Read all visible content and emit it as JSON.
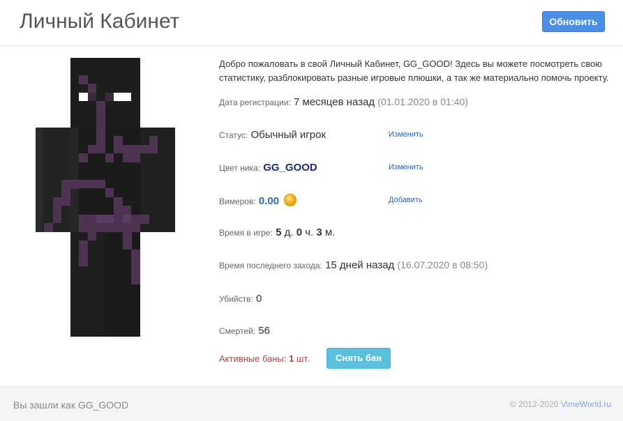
{
  "header": {
    "title": "Личный Кабинет",
    "refresh_label": "Обновить"
  },
  "welcome_text": "Добро пожаловать в свой Личный Кабинет, GG_GOOD! Здесь вы можете посмотреть свою статистику, разблокировать разные игровые плюшки, а так же материально помочь проекту.",
  "stats": {
    "registration": {
      "label": "Дата регистрации:",
      "value": "7 месяцев назад",
      "detail": "(01.01.2020 в 01:40)"
    },
    "status": {
      "label": "Статус:",
      "value": "Обычный игрок",
      "action": "Изменить"
    },
    "nick_color": {
      "label": "Цвет ника:",
      "value": "GG_GOOD",
      "action": "Изменить",
      "color": "#1a2a8a"
    },
    "vimers": {
      "label": "Вимеров:",
      "value": "0.00",
      "action": "Добавить",
      "icon": "coin-icon"
    },
    "playtime": {
      "label": "Время в игре:",
      "days": "5",
      "days_unit": "д.",
      "hours": "0",
      "hours_unit": "ч.",
      "minutes": "3",
      "minutes_unit": "м."
    },
    "last_login": {
      "label": "Время последнего захода:",
      "value": "15 дней назад",
      "detail": "(16.07.2020 в 08:50)"
    },
    "kills": {
      "label": "Убийств:",
      "value": "0"
    },
    "deaths": {
      "label": "Смертей:",
      "value": "56"
    },
    "bans": {
      "label": "Активные баны:",
      "count": "1",
      "unit": "шт.",
      "action": "Снять бан"
    }
  },
  "footer": {
    "logged_in": "Вы зашли как GG_GOOD",
    "copyright": "© 2012-2020",
    "brand": "VimeWorld.ru"
  },
  "colors": {
    "primary": "#4a8ee6",
    "info": "#5bc0de",
    "danger": "#a94442",
    "skin_dark": "#1c1c1c",
    "skin_purple": "#4d3450"
  }
}
